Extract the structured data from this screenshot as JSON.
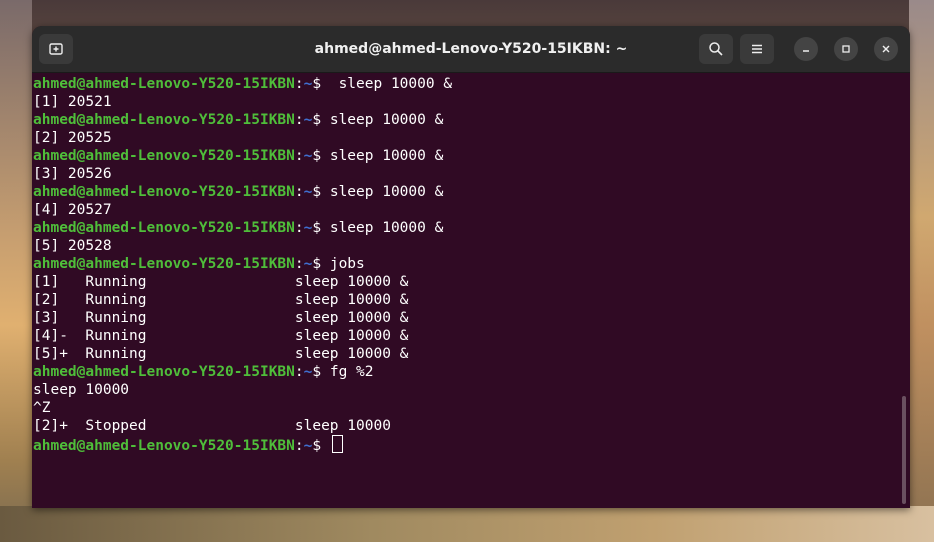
{
  "window": {
    "title": "ahmed@ahmed-Lenovo-Y520-15IKBN: ~"
  },
  "prompt": {
    "user_host": "ahmed@ahmed-Lenovo-Y520-15IKBN",
    "colon": ":",
    "path": "~",
    "symbol": "$"
  },
  "lines": [
    {
      "type": "cmd",
      "text": "  sleep 10000 &"
    },
    {
      "type": "out",
      "text": "[1] 20521"
    },
    {
      "type": "cmd",
      "text": " sleep 10000 &"
    },
    {
      "type": "out",
      "text": "[2] 20525"
    },
    {
      "type": "cmd",
      "text": " sleep 10000 &"
    },
    {
      "type": "out",
      "text": "[3] 20526"
    },
    {
      "type": "cmd",
      "text": " sleep 10000 &"
    },
    {
      "type": "out",
      "text": "[4] 20527"
    },
    {
      "type": "cmd",
      "text": " sleep 10000 &"
    },
    {
      "type": "out",
      "text": "[5] 20528"
    },
    {
      "type": "cmd",
      "text": " jobs"
    },
    {
      "type": "out",
      "text": "[1]   Running                 sleep 10000 &"
    },
    {
      "type": "out",
      "text": "[2]   Running                 sleep 10000 &"
    },
    {
      "type": "out",
      "text": "[3]   Running                 sleep 10000 &"
    },
    {
      "type": "out",
      "text": "[4]-  Running                 sleep 10000 &"
    },
    {
      "type": "out",
      "text": "[5]+  Running                 sleep 10000 &"
    },
    {
      "type": "cmd",
      "text": " fg %2"
    },
    {
      "type": "out",
      "text": "sleep 10000"
    },
    {
      "type": "out",
      "text": "^Z"
    },
    {
      "type": "out",
      "text": "[2]+  Stopped                 sleep 10000"
    },
    {
      "type": "prompt",
      "text": " "
    }
  ],
  "icons": {
    "new_tab": "new-tab-icon",
    "search": "search-icon",
    "menu": "hamburger-menu-icon",
    "minimize": "minimize-icon",
    "maximize": "maximize-icon",
    "close": "close-icon"
  },
  "colors": {
    "terminal_bg": "#300a24",
    "prompt_user": "#4fbe3a",
    "prompt_path": "#3f6fd0",
    "text": "#ffffff",
    "titlebar_bg": "#2b2b2b"
  }
}
